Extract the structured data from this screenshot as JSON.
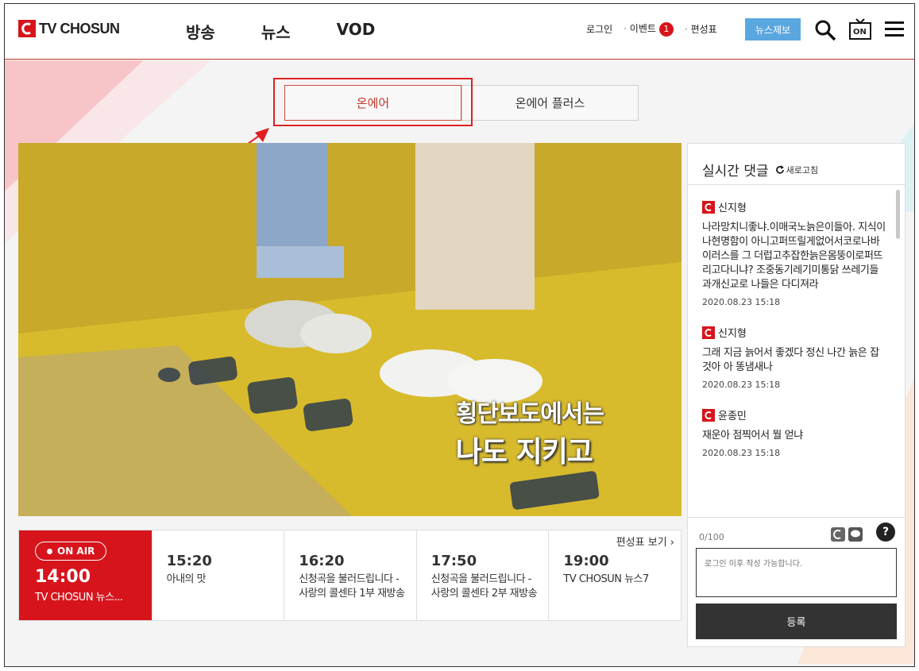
{
  "header": {
    "logo_text": "TV CHOSUN",
    "nav": [
      "방송",
      "뉴스",
      "VOD"
    ],
    "util": {
      "login": "로그인",
      "event": "이벤트",
      "event_count": "1",
      "schedule": "편성표"
    },
    "report_button": "뉴스제보",
    "icons": {
      "search": "search-icon",
      "onair": "tv-on-icon",
      "menu": "hamburger-menu-icon"
    },
    "onair_icon_text": "ON"
  },
  "tabs": [
    {
      "label": "온에어",
      "active": true
    },
    {
      "label": "온에어 플러스",
      "active": false
    }
  ],
  "video": {
    "caption_line1": "횡단보도에서는",
    "caption_line2": "나도 지키고"
  },
  "schedule": {
    "onair_badge": "ON AIR",
    "current_time": "14:00",
    "current_title": "TV CHOSUN 뉴스...",
    "link_label": "편성표 보기",
    "slots": [
      {
        "time": "15:20",
        "title": "아내의 맛"
      },
      {
        "time": "16:20",
        "title": "신청곡을 불러드립니다 - 사랑의 콜센타 1부 재방송"
      },
      {
        "time": "17:50",
        "title": "신청곡을 불러드립니다 - 사랑의 콜센타 2부 재방송"
      },
      {
        "time": "19:00",
        "title": "TV CHOSUN 뉴스7"
      }
    ]
  },
  "comments": {
    "title": "실시간 댓글",
    "refresh_label": "새로고침",
    "items": [
      {
        "user": "신지형",
        "body": "나라망치니좋냐.이매국노늙은이들아. 지식이나현명함이 아니고퍼뜨릴게없어서코로나바이러스를 그 더럽고추잡한늙은몸뚱이로퍼뜨리고다니냐? 조중동기레기미통닭 쓰레기들과개신교로 나들은 다디져라",
        "date": "2020.08.23 15:18"
      },
      {
        "user": "신지형",
        "body": "그래 지금 늙어서 좋겠다 정신 나간 늙은 잡것아 아 똥냄새나",
        "date": "2020.08.23 15:18"
      },
      {
        "user": "윤종민",
        "body": "재운아 점찍어서 뭘 얻냐",
        "date": "2020.08.23 15:18"
      }
    ],
    "counter": "0/100",
    "placeholder": "로그인 이후 작성 가능합니다.",
    "submit_label": "등록",
    "help_label": "?"
  },
  "colors": {
    "brand_red": "#d7141c",
    "accent_blue": "#5aa7e0"
  }
}
